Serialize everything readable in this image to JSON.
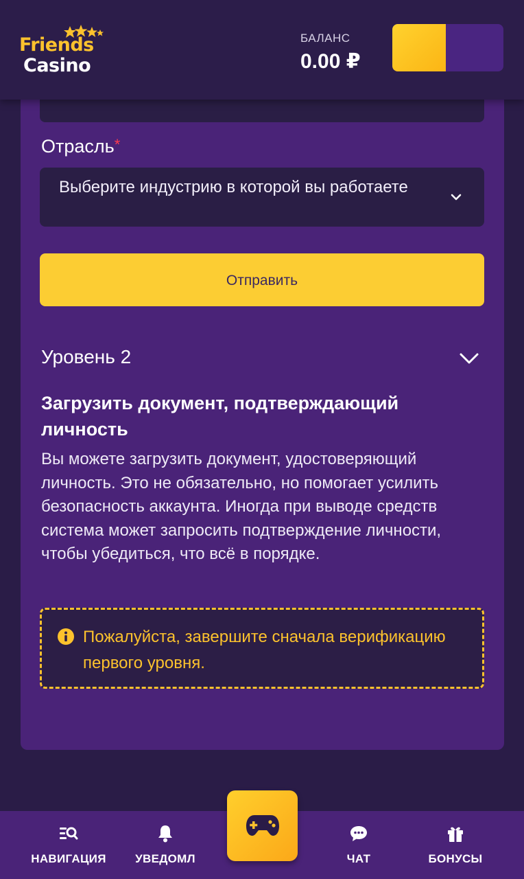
{
  "header": {
    "logo_line1": "Friends",
    "logo_line2": "Casino",
    "balance_label": "БАЛАНС",
    "balance_value": "0.00 ₽"
  },
  "form": {
    "industry_label": "Отрасль",
    "required_mark": "*",
    "industry_placeholder": "Выберите индустрию в которой вы работаете",
    "submit_label": "Отправить"
  },
  "level2": {
    "title": "Уровень 2",
    "heading": "Загрузить документ, подтверждающий личность",
    "description": "Вы можете загрузить документ, удостоверяющий личность. Это не обязательно, но помогает усилить безопасность аккаунта. Иногда при выводе средств система может запросить подтверждение личности, чтобы убедиться, что всё в порядке.",
    "warning": "Пожалуйста, завершите сначала верификацию первого уровня."
  },
  "bottom_nav": {
    "items": [
      {
        "label": "НАВИГАЦИЯ",
        "icon": "search-menu-icon"
      },
      {
        "label": "УВЕДОМЛ",
        "icon": "bell-icon"
      },
      {
        "label": "",
        "icon": "gamepad-icon"
      },
      {
        "label": "ЧАТ",
        "icon": "chat-bubble-icon"
      },
      {
        "label": "БОНУСЫ",
        "icon": "gift-icon"
      }
    ]
  },
  "colors": {
    "background": "#2a1c47",
    "card": "#4a2378",
    "accent_yellow": "#fccd33",
    "warning_yellow": "#fcc22d",
    "required_red": "#ff3b4e",
    "input_bg": "#2a1e45"
  }
}
